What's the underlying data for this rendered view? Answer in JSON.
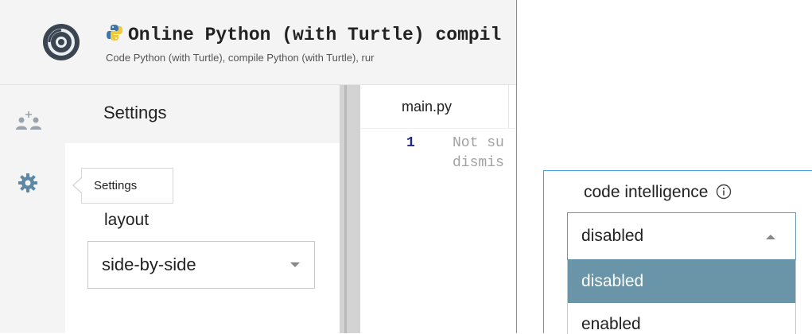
{
  "header": {
    "title": "Online Python (with Turtle) compil",
    "subtitle": "Code Python (with Turtle), compile Python (with Turtle), rur"
  },
  "rail": {
    "icons": [
      "add-user-icon",
      "gear-icon"
    ]
  },
  "settings_panel": {
    "title": "Settings",
    "tooltip": "Settings",
    "layout_label": "layout",
    "layout_value": "side-by-side"
  },
  "editor": {
    "tab": "main.py",
    "line_number": "1",
    "code_lines": [
      "Not su",
      "dismis"
    ]
  },
  "code_intelligence": {
    "label": "code intelligence",
    "selected": "disabled",
    "options": [
      "disabled",
      "enabled"
    ]
  },
  "colors": {
    "accent_border": "#4a9fd8",
    "selected_option_bg": "#6a95a8",
    "line_number": "#1f2a80"
  }
}
